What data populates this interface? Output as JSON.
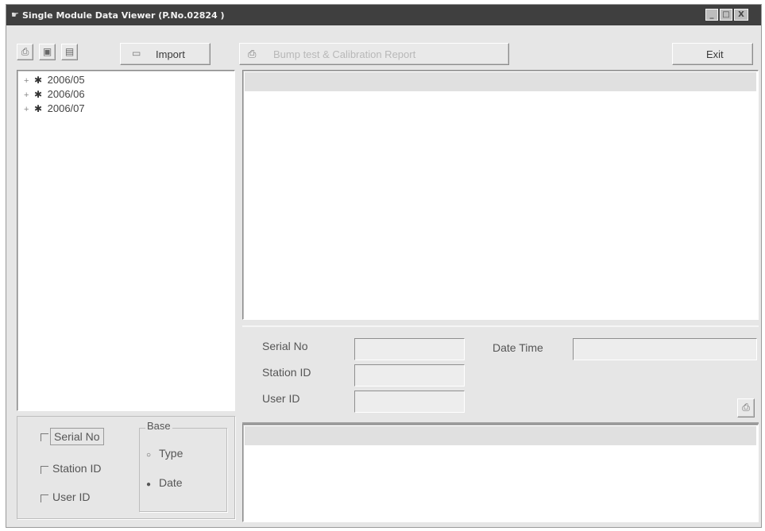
{
  "window": {
    "title": "Single Module Data Viewer (P.No.02824 )",
    "min_glyph": "_",
    "max_glyph": "□",
    "close_glyph": "X"
  },
  "toolbar": {
    "print_icon": "print-icon",
    "save_icon": "save-icon",
    "clipboard_icon": "clipboard-icon",
    "import_label": "Import",
    "report_label": "Bump test & Calibration Report",
    "exit_label": "Exit"
  },
  "tree": {
    "items": [
      {
        "label": "2006/05"
      },
      {
        "label": "2006/06"
      },
      {
        "label": "2006/07"
      }
    ]
  },
  "filter": {
    "serial_label": "Serial No",
    "station_label": "Station ID",
    "user_label": "User ID",
    "base_legend": "Base",
    "type_label": "Type",
    "date_label": "Date",
    "selected_base": "Date"
  },
  "details": {
    "serial_label": "Serial No",
    "station_label": "Station ID",
    "user_label": "User ID",
    "datetime_label": "Date Time",
    "serial_value": "",
    "station_value": "",
    "user_value": "",
    "datetime_value": ""
  }
}
